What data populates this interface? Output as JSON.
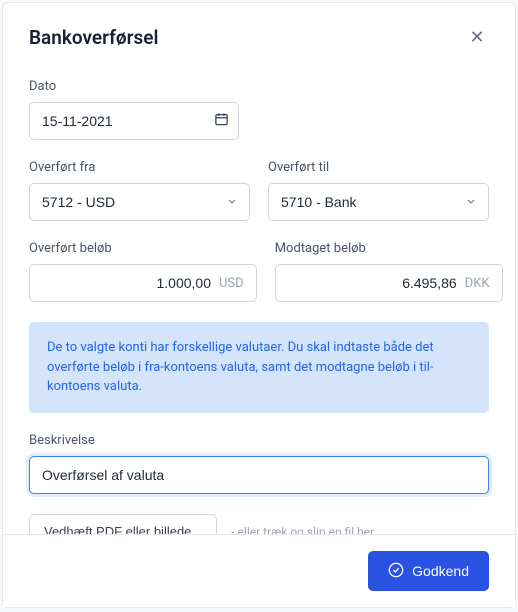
{
  "modal": {
    "title": "Bankoverførsel"
  },
  "date": {
    "label": "Dato",
    "value": "15-11-2021"
  },
  "from": {
    "label": "Overført fra",
    "value": "5712 - USD"
  },
  "to": {
    "label": "Overført til",
    "value": "5710 - Bank"
  },
  "amount_out": {
    "label": "Overført beløb",
    "value": "1.000,00",
    "currency": "USD"
  },
  "amount_in": {
    "label": "Modtaget beløb",
    "value": "6.495,86",
    "currency": "DKK"
  },
  "info": {
    "text": "De to valgte konti har forskellige valutaer. Du skal indtaste både det overførte beløb i fra-kontoens valuta, samt det modtagne beløb i til-kontoens valuta."
  },
  "description": {
    "label": "Beskrivelse",
    "value": "Overførsel af valuta"
  },
  "attach": {
    "button": "Vedhæft PDF eller billede...",
    "hint": "- eller træk og slip en fil her"
  },
  "footer": {
    "approve": "Godkend"
  }
}
